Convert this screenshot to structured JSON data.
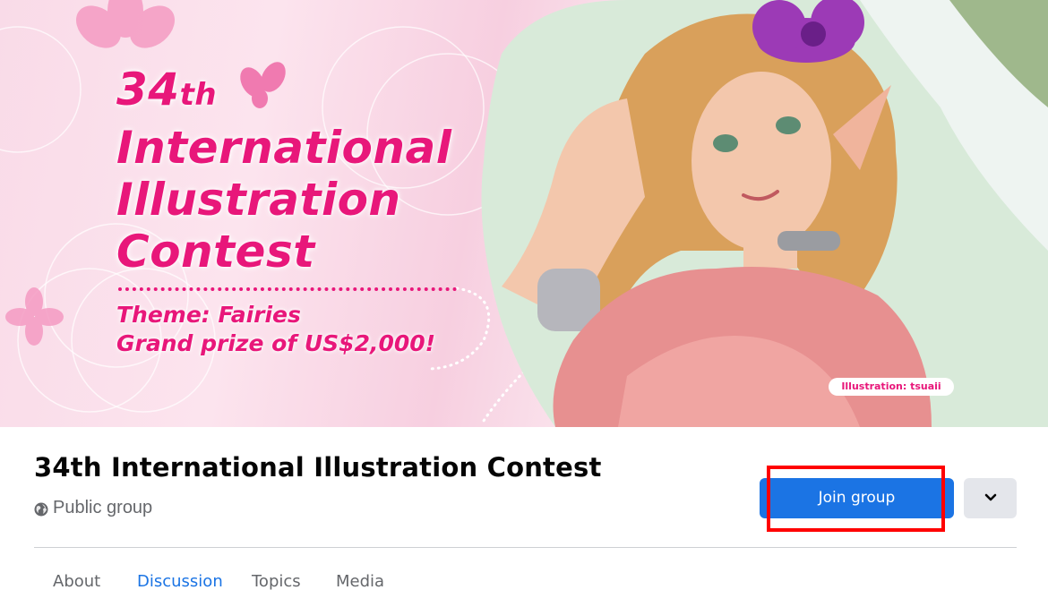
{
  "cover": {
    "ordinal_number": "34",
    "ordinal_suffix": "th",
    "title_line_1": "International",
    "title_line_2": "Illustration",
    "title_line_3": "Contest",
    "theme": "Theme: Fairies",
    "prize": "Grand prize of US$2,000!",
    "credit": "Illustration: tsuaii"
  },
  "group": {
    "title": "34th International Illustration Contest",
    "privacy": "Public group",
    "privacy_icon": "globe-icon"
  },
  "actions": {
    "join_label": "Join group",
    "more_icon": "chevron-down-icon"
  },
  "tabs": [
    {
      "label": "About",
      "active": false
    },
    {
      "label": "Discussion",
      "active": true
    },
    {
      "label": "Topics",
      "active": false
    },
    {
      "label": "Media",
      "active": false
    }
  ],
  "colors": {
    "brand_blue": "#1b74e4",
    "cover_pink": "#e8177a",
    "highlight_red": "#ff0000"
  }
}
